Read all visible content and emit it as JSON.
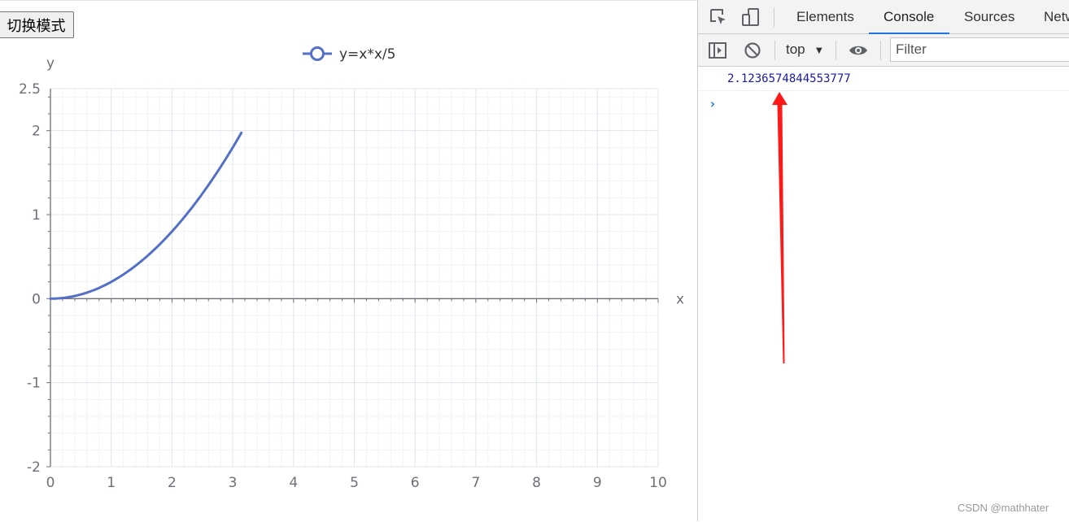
{
  "toggle_button": {
    "label": "切换模式"
  },
  "chart_data": {
    "type": "line",
    "title": "",
    "xlabel": "x",
    "ylabel": "y",
    "xlim": [
      0,
      10
    ],
    "ylim": [
      -2,
      2.5
    ],
    "xticks": [
      0,
      1,
      2,
      3,
      4,
      5,
      6,
      7,
      8,
      9,
      10
    ],
    "yticks": [
      -2,
      -1,
      0,
      1,
      2,
      2.5
    ],
    "grid": true,
    "legend_position": "top-center",
    "series": [
      {
        "name": "y=x*x/5",
        "color": "#5470c6",
        "x_range": [
          0,
          3.1416
        ],
        "formula": "y=x*x/5",
        "x": [
          0,
          0.5,
          1,
          1.5,
          2,
          2.5,
          3,
          3.1416
        ],
        "y": [
          0,
          0.05,
          0.2,
          0.45,
          0.8,
          1.25,
          1.8,
          1.974
        ]
      }
    ]
  },
  "devtools": {
    "tabs": [
      {
        "label": "Elements",
        "active": false
      },
      {
        "label": "Console",
        "active": true
      },
      {
        "label": "Sources",
        "active": false
      },
      {
        "label": "Netw",
        "active": false
      }
    ],
    "context": "top",
    "filter_placeholder": "Filter",
    "console_output": "2.1236574844553777",
    "prompt_symbol": "›",
    "accent_color": "#1a73e8",
    "output_color": "#1a1aa6"
  },
  "annotation": {
    "arrow_color": "#ff1a1a"
  },
  "watermark": "CSDN @mathhater"
}
